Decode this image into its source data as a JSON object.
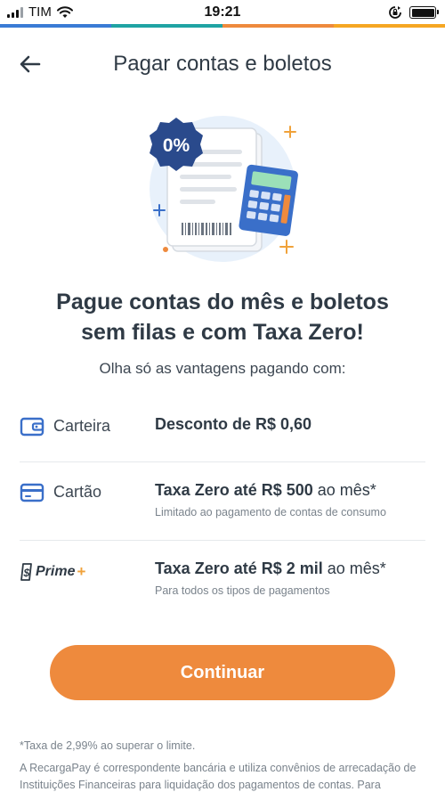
{
  "status_bar": {
    "carrier": "TIM",
    "time": "19:21"
  },
  "header": {
    "title": "Pagar contas e boletos",
    "back_icon": "arrow-left-icon"
  },
  "hero": {
    "badge_text": "0%"
  },
  "headline": {
    "line1": "Pague contas do mês e boletos",
    "line2": "sem filas e com Taxa Zero!"
  },
  "subhead": "Olha só as vantagens pagando com:",
  "benefits": [
    {
      "icon": "wallet-icon",
      "label": "Carteira",
      "main_bold": "Desconto de R$ 0,60",
      "main_rest": "",
      "sub": ""
    },
    {
      "icon": "card-icon",
      "label": "Cartão",
      "main_bold": "Taxa Zero até R$ 500",
      "main_rest": " ao mês*",
      "sub": "Limitado ao pagamento de contas de consumo"
    },
    {
      "icon": "prime-logo",
      "label": "Prime",
      "label_plus": "+",
      "main_bold": "Taxa Zero até R$ 2 mil",
      "main_rest": " ao mês*",
      "sub": "Para todos os tipos de pagamentos"
    }
  ],
  "cta_label": "Continuar",
  "footnote": "*Taxa de 2,99% ao superar o limite.",
  "disclaimer": "A RecargaPay é correspondente bancária e utiliza convênios de arrecadação de Instituições Financeiras para liquidação dos pagamentos de contas. Para",
  "colors": {
    "accent": "#ee8a3d",
    "icon_blue": "#3a6fc9",
    "text_dark": "#2f3a45",
    "text_muted": "#7a838c",
    "strip": [
      "#3a7bd5",
      "#1fa3a3",
      "#ee8a3d",
      "#f5a623"
    ]
  }
}
